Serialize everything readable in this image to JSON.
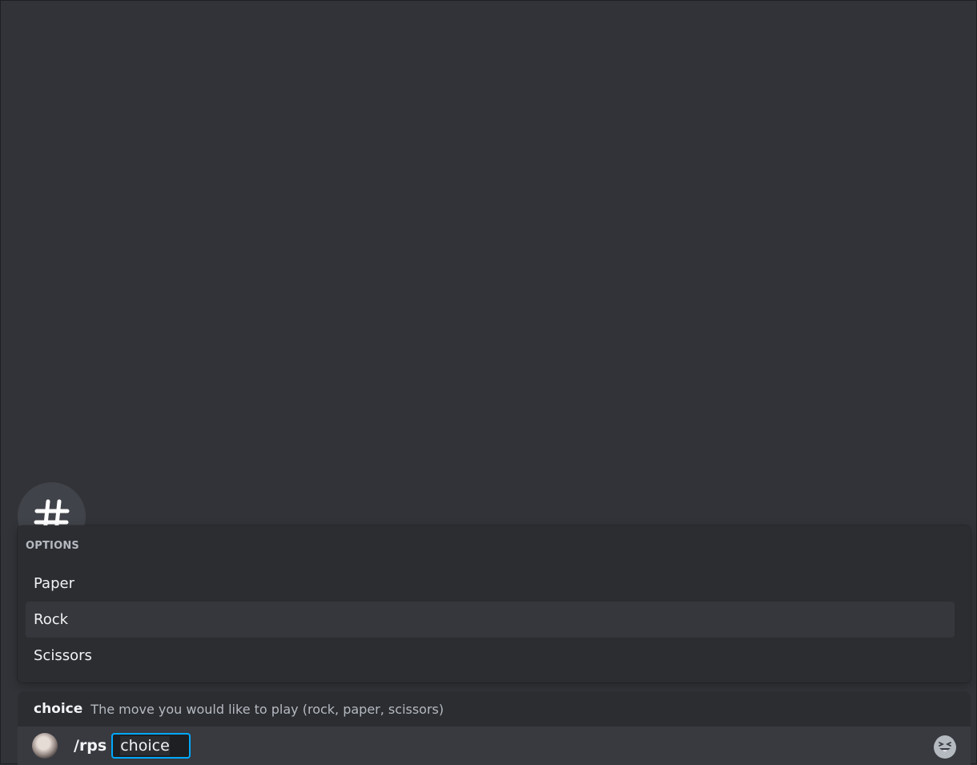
{
  "options_popup": {
    "header": "OPTIONS",
    "items": [
      {
        "label": "Paper",
        "selected": false
      },
      {
        "label": "Rock",
        "selected": true
      },
      {
        "label": "Scissors",
        "selected": false
      }
    ]
  },
  "param_hint": {
    "name": "choice",
    "description": "The move you would like to play (rock, paper, scissors)"
  },
  "input": {
    "command": "/rps",
    "param_label": "choice"
  },
  "icons": {
    "channel": "hash-icon",
    "emoji": "emoji-icon"
  },
  "colors": {
    "background": "#313338",
    "popup": "#2b2d31",
    "selected_row": "#35373c",
    "input_bar": "#383a40",
    "focus_accent": "#00a8fc"
  }
}
